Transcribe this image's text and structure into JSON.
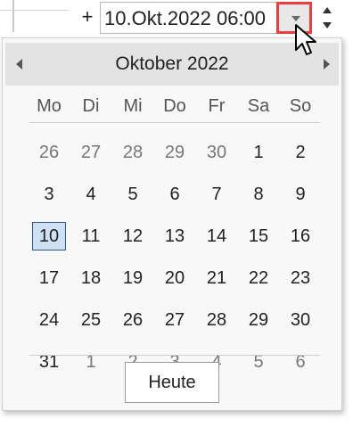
{
  "toolbar": {
    "plus_label": "+"
  },
  "datetime_field": {
    "value": "10.Okt.2022 06:00"
  },
  "calendar": {
    "month_title": "Oktober 2022",
    "weekdays": [
      "Mo",
      "Di",
      "Mi",
      "Do",
      "Fr",
      "Sa",
      "So"
    ],
    "weeks": [
      [
        {
          "d": "26",
          "other": true
        },
        {
          "d": "27",
          "other": true
        },
        {
          "d": "28",
          "other": true
        },
        {
          "d": "29",
          "other": true
        },
        {
          "d": "30",
          "other": true
        },
        {
          "d": "1"
        },
        {
          "d": "2"
        }
      ],
      [
        {
          "d": "3"
        },
        {
          "d": "4"
        },
        {
          "d": "5"
        },
        {
          "d": "6"
        },
        {
          "d": "7"
        },
        {
          "d": "8"
        },
        {
          "d": "9"
        }
      ],
      [
        {
          "d": "10",
          "selected": true
        },
        {
          "d": "11"
        },
        {
          "d": "12"
        },
        {
          "d": "13"
        },
        {
          "d": "14"
        },
        {
          "d": "15"
        },
        {
          "d": "16"
        }
      ],
      [
        {
          "d": "17"
        },
        {
          "d": "18"
        },
        {
          "d": "19"
        },
        {
          "d": "20"
        },
        {
          "d": "21"
        },
        {
          "d": "22"
        },
        {
          "d": "23"
        }
      ],
      [
        {
          "d": "24"
        },
        {
          "d": "25"
        },
        {
          "d": "26"
        },
        {
          "d": "27"
        },
        {
          "d": "28"
        },
        {
          "d": "29"
        },
        {
          "d": "30"
        }
      ],
      [
        {
          "d": "31"
        },
        {
          "d": "1",
          "other": true
        },
        {
          "d": "2",
          "other": true
        },
        {
          "d": "3",
          "other": true
        },
        {
          "d": "4",
          "other": true
        },
        {
          "d": "5",
          "other": true
        },
        {
          "d": "6",
          "other": true
        }
      ]
    ],
    "today_label": "Heute"
  },
  "icons": {
    "dropdown": "chevron-down-icon",
    "spin_up": "arrow-up-icon",
    "spin_down": "arrow-down-icon",
    "prev": "arrow-left-icon",
    "next": "arrow-right-icon",
    "cursor": "mouse-pointer-icon"
  },
  "colors": {
    "highlight_border": "#ee3d3d",
    "selected_day_bg": "#cfe0f5",
    "selected_day_border": "#2f5a8a",
    "header_bg": "#e3e3e3"
  }
}
